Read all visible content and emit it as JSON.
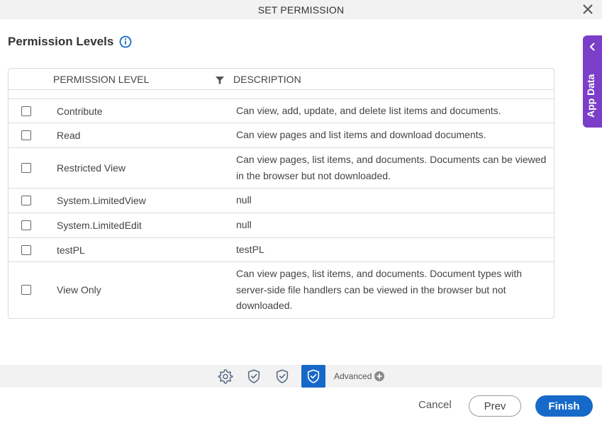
{
  "dialog": {
    "title": "SET PERMISSION"
  },
  "section": {
    "title": "Permission Levels"
  },
  "grid": {
    "columns": {
      "level": "PERMISSION LEVEL",
      "description": "DESCRIPTION"
    },
    "rows": [
      {
        "level": "Contribute",
        "description": "Can view, add, update, and delete list items and documents.",
        "checked": false
      },
      {
        "level": "Read",
        "description": "Can view pages and list items and download documents.",
        "checked": false
      },
      {
        "level": "Restricted View",
        "description": "Can view pages, list items, and documents. Documents can be viewed in the browser but not downloaded.",
        "checked": false
      },
      {
        "level": "System.LimitedView",
        "description": "null",
        "checked": false
      },
      {
        "level": "System.LimitedEdit",
        "description": "null",
        "checked": false
      },
      {
        "level": "testPL",
        "description": "testPL",
        "checked": false
      },
      {
        "level": "View Only",
        "description": "Can view pages, list items, and documents. Document types with server-side file handlers can be viewed in the browser but not downloaded.",
        "checked": false
      }
    ]
  },
  "wizard": {
    "steps": [
      {
        "icon": "gear-icon",
        "active": false
      },
      {
        "icon": "shield-check-icon",
        "active": false
      },
      {
        "icon": "shield-check-icon",
        "active": false
      },
      {
        "icon": "shield-check-icon",
        "active": true
      }
    ],
    "advanced_label": "Advanced"
  },
  "footer": {
    "cancel_label": "Cancel",
    "prev_label": "Prev",
    "finish_label": "Finish"
  },
  "side_panel": {
    "label": "App Data"
  },
  "colors": {
    "primary": "#1769c9",
    "app_data_tab": "#7a3ec8",
    "header_bg": "#f2f2f2"
  }
}
